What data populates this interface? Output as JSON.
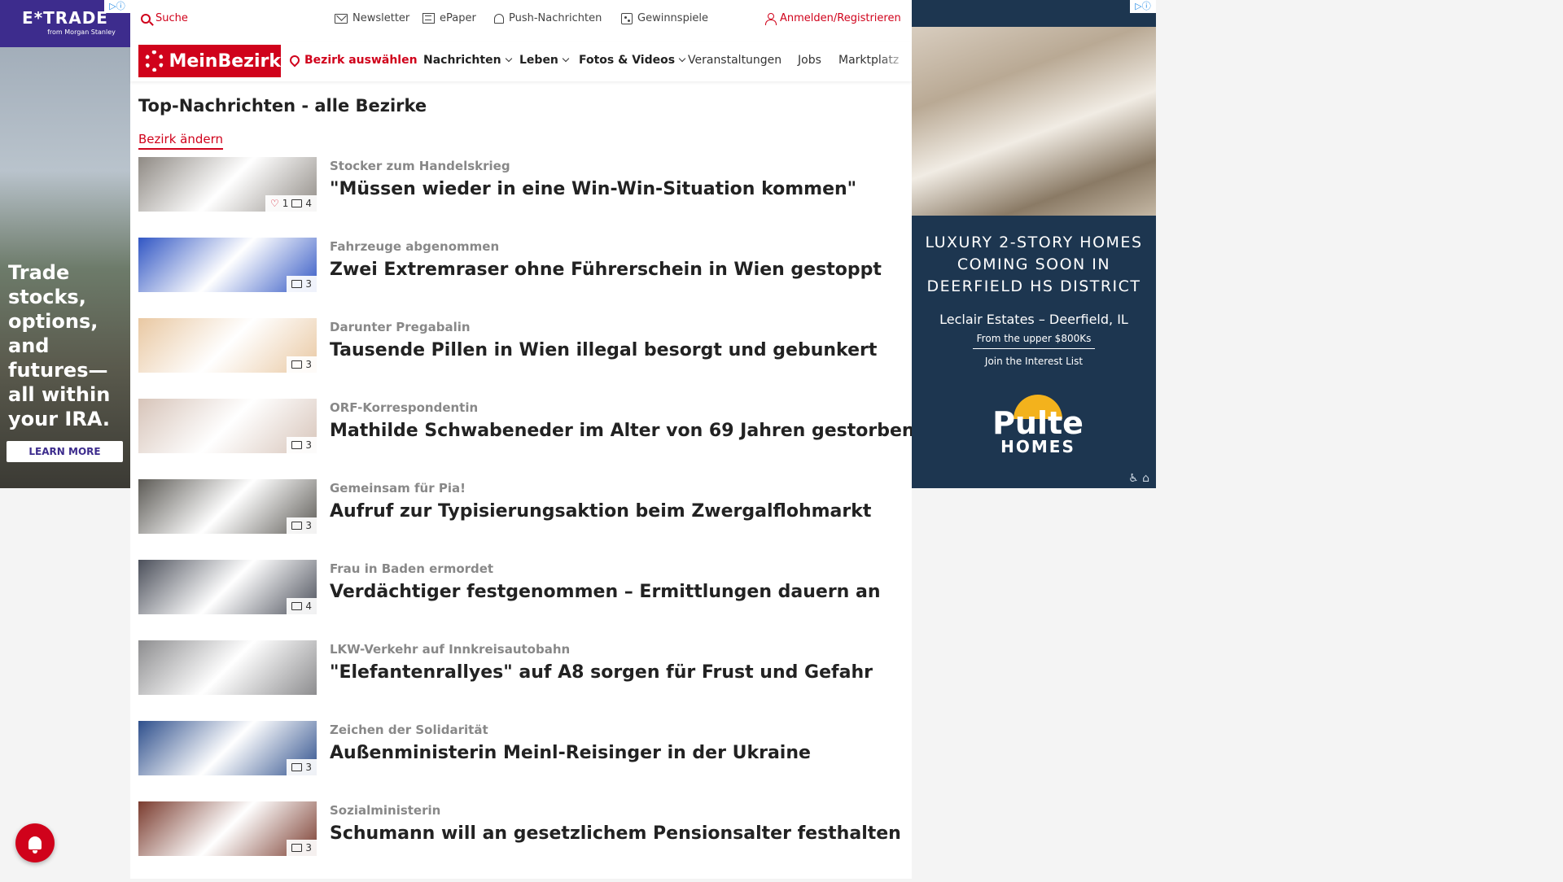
{
  "ads": {
    "left": {
      "brand": "E*TRADE",
      "brand_sub": "from Morgan Stanley",
      "copy": "Trade stocks, options, and futures—all within your IRA.",
      "cta": "LEARN MORE"
    },
    "right": {
      "headline": "LUXURY 2-STORY HOMES COMING SOON IN DEERFIELD HS DISTRICT",
      "location": "Leclair Estates – Deerfield, IL",
      "price": "From the upper $800Ks",
      "cta": "Join the Interest List",
      "brand_word1": "Pulte",
      "brand_word2": "HOMES"
    }
  },
  "topbar": {
    "search": "Suche",
    "newsletter": "Newsletter",
    "epaper": "ePaper",
    "push": "Push-Nachrichten",
    "games": "Gewinnspiele",
    "login": "Anmelden/Registrieren"
  },
  "nav": {
    "logo": "MeinBezirk",
    "district": "Bezirk auswählen",
    "items": [
      "Nachrichten",
      "Leben",
      "Fotos & Videos",
      "Veranstaltungen",
      "Jobs",
      "Marktplatz"
    ]
  },
  "page": {
    "title": "Top-Nachrichten - alle Bezirke",
    "change_district": "Bezirk ändern"
  },
  "articles": [
    {
      "kicker": "Stocker zum Handelskrieg",
      "headline": "\"Müssen wieder in eine Win-Win-Situation kommen\"",
      "likes": "1",
      "images": "4",
      "thumb": "#8f8a84"
    },
    {
      "kicker": "Fahrzeuge abgenommen",
      "headline": "Zwei Extremraser ohne Führerschein in Wien gestoppt",
      "likes": "",
      "images": "3",
      "thumb": "#3156c4"
    },
    {
      "kicker": "Darunter Pregabalin",
      "headline": "Tausende Pillen in Wien illegal besorgt und gebunkert",
      "likes": "",
      "images": "3",
      "thumb": "#e9c8a2"
    },
    {
      "kicker": "ORF-Korrespondentin",
      "headline": "Mathilde Schwabeneder im Alter von 69 Jahren gestorben",
      "likes": "",
      "images": "3",
      "thumb": "#d7c4b9"
    },
    {
      "kicker": "Gemeinsam für Pia!",
      "headline": "Aufruf zur Typisierungsaktion beim Zwergalflohmarkt",
      "likes": "",
      "images": "3",
      "thumb": "#5c5a55"
    },
    {
      "kicker": "Frau in Baden ermordet",
      "headline": "Verdächtiger festgenommen – Ermittlungen dauern an",
      "likes": "",
      "images": "4",
      "thumb": "#4b4f5a"
    },
    {
      "kicker": "LKW-Verkehr auf Innkreisautobahn",
      "headline": "\"Elefantenrallyes\" auf A8 sorgen für Frust und Gefahr",
      "likes": "",
      "images": "",
      "thumb": "#8d8d8f"
    },
    {
      "kicker": "Zeichen der Solidarität",
      "headline": "Außenministerin Meinl-Reisinger in der Ukraine",
      "likes": "",
      "images": "3",
      "thumb": "#2e4f8c"
    },
    {
      "kicker": "Sozialministerin",
      "headline": "Schumann will an gesetzlichem Pensionsalter festhalten",
      "likes": "",
      "images": "3",
      "thumb": "#7a3b2e"
    }
  ]
}
